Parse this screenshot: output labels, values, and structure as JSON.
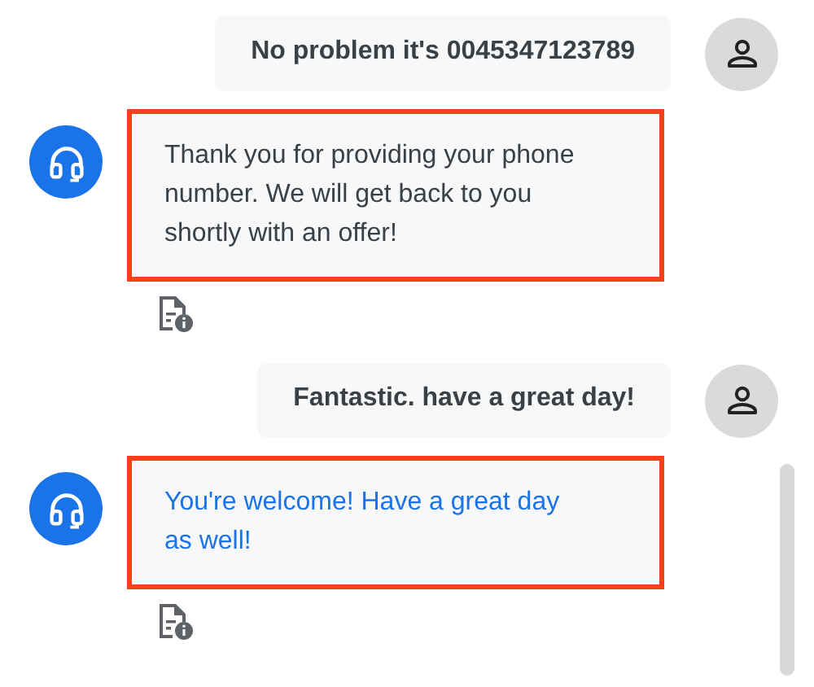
{
  "messages": [
    {
      "kind": "user",
      "text": "No problem it's 0045347123789"
    },
    {
      "kind": "agent",
      "text": "Thank you for providing your phone number. We will get back to you shortly with an offer!",
      "highlighted": true,
      "color": "#3c4043"
    },
    {
      "kind": "user",
      "text": "Fantastic. have a great day!"
    },
    {
      "kind": "agent",
      "text": "You're welcome! Have a great day as well!",
      "highlighted": true,
      "color": "#1a73e8"
    }
  ]
}
